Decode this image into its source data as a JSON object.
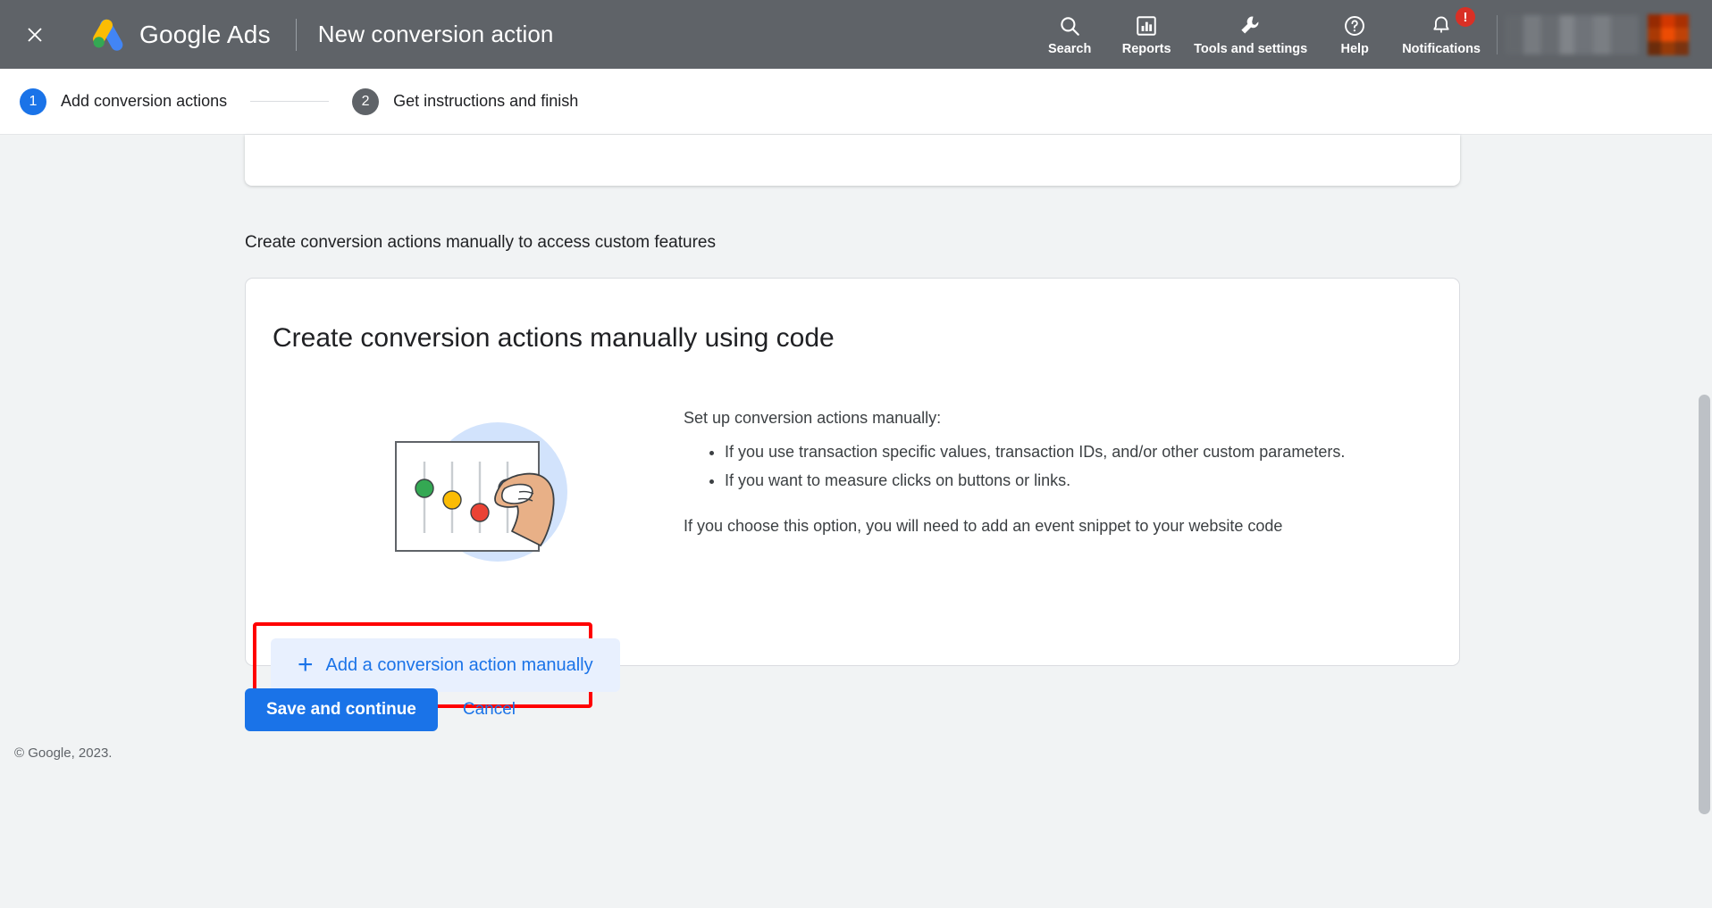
{
  "appbar": {
    "close_icon": "close-icon",
    "logo_icon": "google-ads-logo",
    "brand": "Google Ads",
    "title": "New conversion action",
    "nav": [
      {
        "label": "Search",
        "icon": "search-icon"
      },
      {
        "label": "Reports",
        "icon": "bar-chart-icon"
      },
      {
        "label": "Tools and settings",
        "icon": "wrench-icon"
      },
      {
        "label": "Help",
        "icon": "help-circle-icon"
      },
      {
        "label": "Notifications",
        "icon": "bell-icon",
        "badge": "!"
      }
    ]
  },
  "stepper": {
    "steps": [
      {
        "number": "1",
        "label": "Add conversion actions",
        "state": "active"
      },
      {
        "number": "2",
        "label": "Get instructions and finish",
        "state": "inactive"
      }
    ]
  },
  "main": {
    "section_heading": "Create conversion actions manually to access custom features",
    "card": {
      "title": "Create conversion actions manually using code",
      "lead": "Set up conversion actions manually:",
      "bullets": [
        "If you use transaction specific values, transaction IDs, and/or other custom parameters.",
        "If you want to measure clicks on buttons or links."
      ],
      "footnote": "If you choose this option, you will need to add an event snippet to your website code",
      "add_button": "Add a conversion action manually",
      "add_button_plus": "+",
      "illustration_icon": "sliders-hand-illustration"
    }
  },
  "actions": {
    "save_label": "Save and continue",
    "cancel_label": "Cancel"
  },
  "footer": {
    "copyright": "© Google, 2023."
  },
  "colors": {
    "appbar_bg": "#5f6368",
    "accent_blue": "#1a73e8",
    "button_bg_light": "#e8f0fe",
    "highlight_red": "#ff0000",
    "badge_red": "#d93025",
    "page_bg": "#f1f3f4"
  }
}
